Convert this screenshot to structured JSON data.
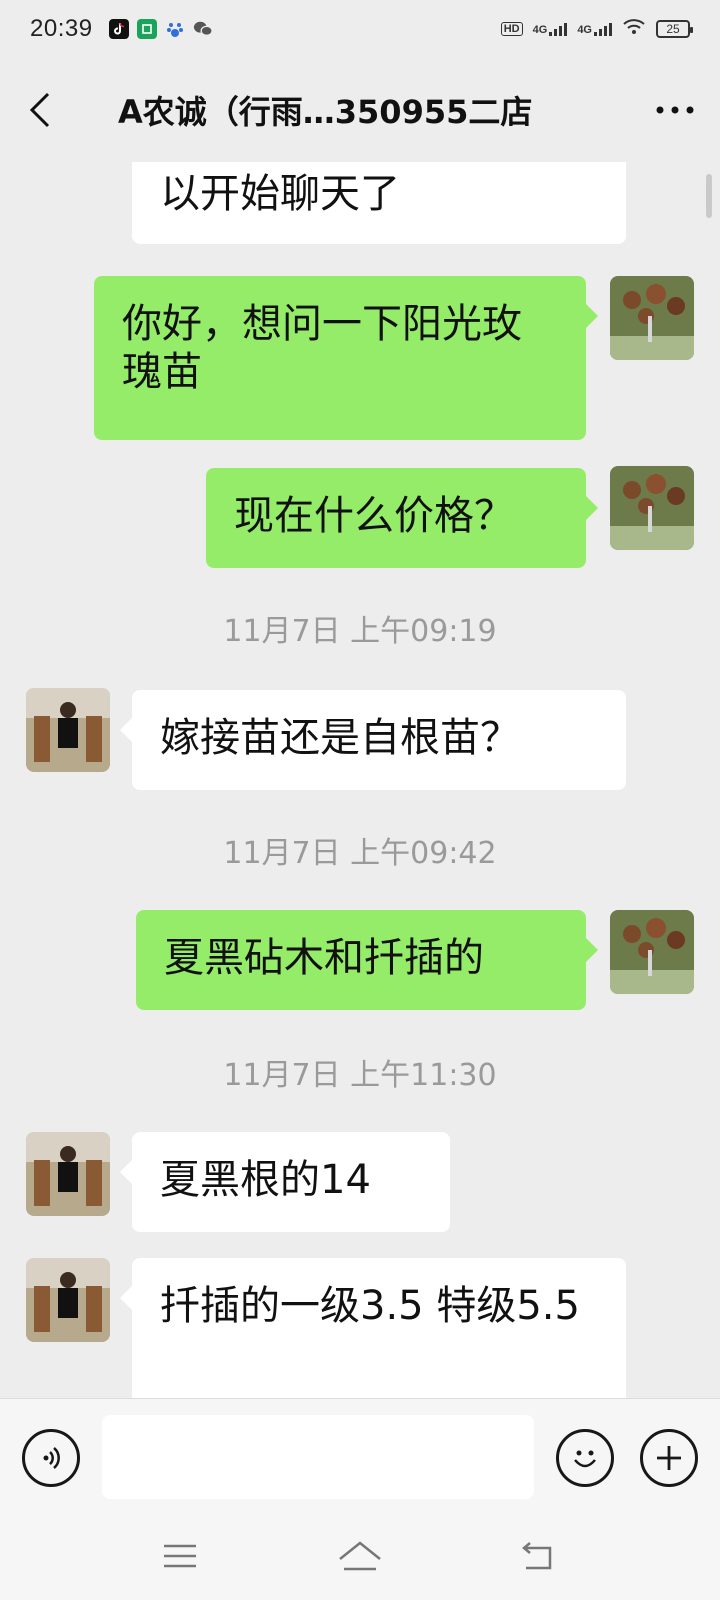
{
  "status_bar": {
    "time": "20:39",
    "network1": "4G",
    "network2": "4G",
    "battery": "25",
    "hd_label": "HD"
  },
  "nav": {
    "title": "A农诚（行雨…350955二店"
  },
  "messages": [
    {
      "side": "in",
      "text": "以开始聊天了"
    },
    {
      "side": "out",
      "text": "你好，想问一下阳光玫瑰苗"
    },
    {
      "side": "out",
      "text": "现在什么价格？"
    },
    {
      "type": "time",
      "text": "11月7日 上午09:19"
    },
    {
      "side": "in",
      "text": "嫁接苗还是自根苗？"
    },
    {
      "type": "time",
      "text": "11月7日 上午09:42"
    },
    {
      "side": "out",
      "text": "夏黑砧木和扦插的"
    },
    {
      "type": "time",
      "text": "11月7日 上午11:30"
    },
    {
      "side": "in",
      "text": "夏黑根的14"
    },
    {
      "side": "in",
      "text": "扦插的一级3.5 特级5.5"
    }
  ],
  "input": {
    "placeholder": ""
  },
  "colors": {
    "background": "#ededed",
    "outgoing_bubble": "#95ec69",
    "incoming_bubble": "#ffffff",
    "timestamp": "#9a9a9a"
  },
  "icons": {
    "back": "chevron-left-icon",
    "more": "more-dots-icon",
    "voice": "voice-icon",
    "emoji": "emoji-icon",
    "plus": "plus-icon",
    "menu": "menu-icon",
    "home": "home-icon",
    "back_nav": "return-icon"
  }
}
